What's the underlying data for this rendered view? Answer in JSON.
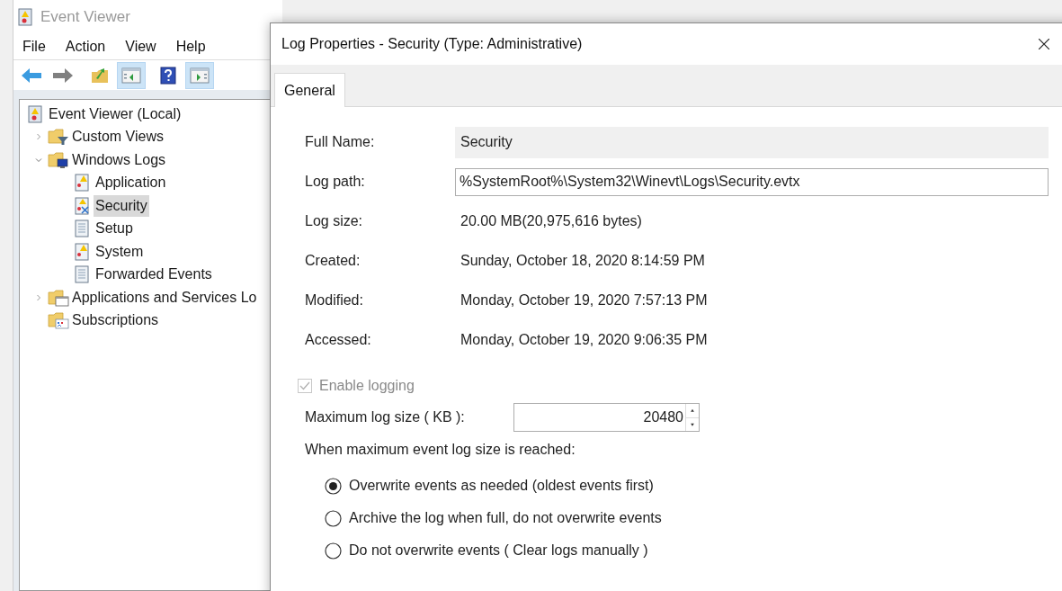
{
  "window": {
    "title": "Event Viewer"
  },
  "menu": [
    "File",
    "Action",
    "View",
    "Help"
  ],
  "toolbar": [
    {
      "kind": "back",
      "pressed": false
    },
    {
      "kind": "forward",
      "pressed": false
    },
    {
      "kind": "folder-up",
      "pressed": false
    },
    {
      "kind": "pane-left",
      "pressed": true
    },
    {
      "kind": "help",
      "pressed": false
    },
    {
      "kind": "pane-right",
      "pressed": true
    }
  ],
  "tree": {
    "label": "Event Viewer (Local)",
    "kind": "root",
    "selected": false,
    "children": [
      {
        "label": "Custom Views",
        "kind": "folder-filter",
        "expanded": false,
        "selected": false
      },
      {
        "label": "Windows Logs",
        "kind": "folder-windows",
        "expanded": true,
        "selected": false,
        "children": [
          {
            "label": "Application",
            "kind": "log-warning",
            "selected": false
          },
          {
            "label": "Security",
            "kind": "log-security",
            "selected": true
          },
          {
            "label": "Setup",
            "kind": "log",
            "selected": false
          },
          {
            "label": "System",
            "kind": "log-warning",
            "selected": false
          },
          {
            "label": "Forwarded Events",
            "kind": "log",
            "selected": false
          }
        ]
      },
      {
        "label": "Applications and Services Lo",
        "kind": "folder-window",
        "expanded": false,
        "selected": false
      },
      {
        "label": "Subscriptions",
        "kind": "folder-calendar",
        "selected": false
      }
    ]
  },
  "dialog": {
    "title": "Log Properties - Security (Type: Administrative)",
    "tabs": [
      {
        "label": "General",
        "selected": true
      }
    ],
    "fields": [
      {
        "label": "Full Name:",
        "value": "Security",
        "kind": "readonly"
      },
      {
        "label": "Log path:",
        "value": "%SystemRoot%\\System32\\Winevt\\Logs\\Security.evtx",
        "kind": "input"
      },
      {
        "label": "Log size:",
        "value": "20.00 MB(20,975,616 bytes)",
        "kind": "text"
      },
      {
        "label": "Created:",
        "value": "Sunday, October 18, 2020 8:14:59 PM",
        "kind": "text"
      },
      {
        "label": "Modified:",
        "value": "Monday, October 19, 2020 7:57:13 PM",
        "kind": "text"
      },
      {
        "label": "Accessed:",
        "value": "Monday, October 19, 2020 9:06:35 PM",
        "kind": "text"
      }
    ],
    "enable_logging": {
      "label": "Enable logging",
      "checked": true,
      "disabled": true
    },
    "max_size": {
      "label": "Maximum log size ( KB ):",
      "value": "20480"
    },
    "policy_label": "When maximum event log size is reached:",
    "policy_options": [
      {
        "label": "Overwrite events as needed (oldest events first)",
        "selected": true
      },
      {
        "label": "Archive the log when full, do not overwrite events",
        "selected": false
      },
      {
        "label": "Do not overwrite events ( Clear logs manually )",
        "selected": false
      }
    ]
  }
}
